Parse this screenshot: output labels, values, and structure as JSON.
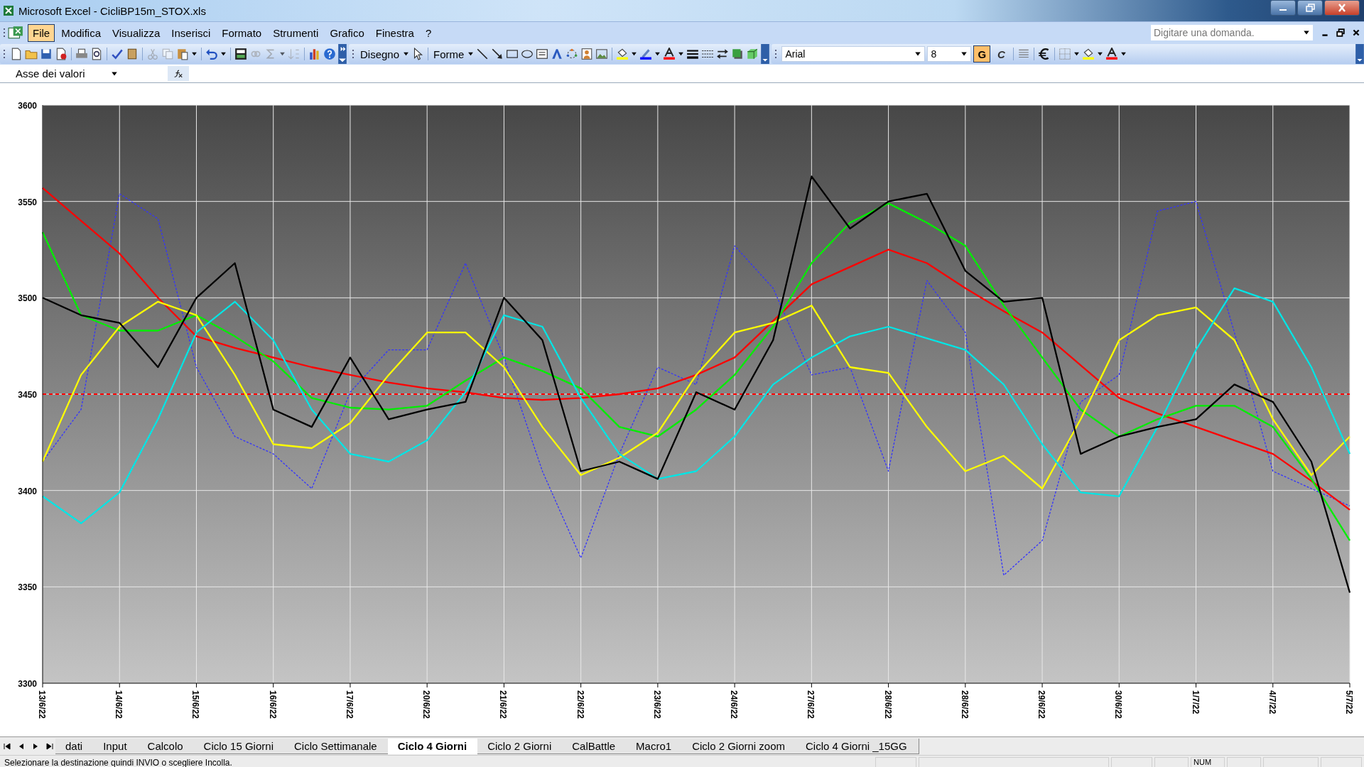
{
  "window": {
    "title": "Microsoft Excel - CicliBP15m_STOX.xls"
  },
  "menu": [
    {
      "label": "File",
      "selected": true
    },
    {
      "label": "Modifica",
      "selected": false
    },
    {
      "label": "Visualizza",
      "selected": false
    },
    {
      "label": "Inserisci",
      "selected": false
    },
    {
      "label": "Formato",
      "selected": false
    },
    {
      "label": "Strumenti",
      "selected": false
    },
    {
      "label": "Grafico",
      "selected": false
    },
    {
      "label": "Finestra",
      "selected": false
    },
    {
      "label": "?",
      "selected": false
    }
  ],
  "help_search": {
    "placeholder": "Digitare una domanda."
  },
  "toolbar": {
    "drawing_menu": "Disegno",
    "shapes_menu": "Forme",
    "font": "Arial",
    "font_size": "8",
    "bold": {
      "label": "G",
      "on": true
    },
    "italic": {
      "label": "C",
      "on": false
    }
  },
  "name_box": "Asse dei valori",
  "chart": {
    "chart_data": {
      "type": "line",
      "ylim": [
        3300,
        3600
      ],
      "yticks": [
        3300,
        3350,
        3400,
        3450,
        3500,
        3550,
        3600
      ],
      "categories": [
        "13/6/22",
        null,
        "14/6/22",
        null,
        "15/6/22",
        null,
        "16/6/22",
        null,
        "17/6/22",
        null,
        "20/6/22",
        null,
        "21/6/22",
        null,
        "22/6/22",
        null,
        "23/6/22",
        null,
        "24/6/22",
        null,
        "27/6/22",
        null,
        "28/6/22",
        null,
        "28/6/22",
        null,
        "29/6/22",
        null,
        "30/6/22",
        null,
        "1/7/22",
        null,
        "4/7/22",
        null,
        "5/7/22"
      ],
      "series": [
        {
          "color": "#ff0000",
          "line_style": "dashed",
          "values": [
            3450,
            3450,
            3450,
            3450,
            3450,
            3450,
            3450,
            3450,
            3450,
            3450,
            3450,
            3450,
            3450,
            3450,
            3450,
            3450,
            3450,
            3450,
            3450,
            3450,
            3450,
            3450,
            3450,
            3450,
            3450,
            3450,
            3450,
            3450,
            3450,
            3450,
            3450,
            3450,
            3450,
            3450,
            3450
          ]
        },
        {
          "color": "#3333ff",
          "line_style": "dotted",
          "values": [
            3415,
            3442,
            3554,
            3541,
            3464,
            3428,
            3419,
            3401,
            3451,
            3473,
            3473,
            3518,
            3469,
            3410,
            3365,
            3419,
            3464,
            3455,
            3527,
            3505,
            3460,
            3464,
            3410,
            3509,
            3482,
            3356,
            3374,
            3446,
            3460,
            3545,
            3550,
            3482,
            3410,
            3401,
            3392
          ]
        },
        {
          "color": "#ff0000",
          "values": [
            3557,
            3540,
            3523,
            3500,
            3480,
            3474,
            3469,
            3464,
            3460,
            3456,
            3453,
            3451,
            3448,
            3447,
            3448,
            3450,
            3453,
            3460,
            3469,
            3488,
            3507,
            3516,
            3525,
            3518,
            3505,
            3493,
            3482,
            3465,
            3448,
            3440,
            3433,
            3426,
            3419,
            3405,
            3390
          ]
        },
        {
          "color": "#00ee00",
          "values": [
            3534,
            3491,
            3483,
            3483,
            3491,
            3480,
            3467,
            3448,
            3443,
            3442,
            3444,
            3457,
            3469,
            3462,
            3453,
            3433,
            3428,
            3442,
            3460,
            3485,
            3518,
            3539,
            3549,
            3539,
            3527,
            3496,
            3469,
            3442,
            3428,
            3437,
            3444,
            3444,
            3433,
            3406,
            3374
          ]
        },
        {
          "color": "#ffff00",
          "values": [
            3415,
            3460,
            3485,
            3498,
            3491,
            3460,
            3424,
            3422,
            3435,
            3460,
            3482,
            3482,
            3464,
            3433,
            3408,
            3417,
            3430,
            3460,
            3482,
            3487,
            3496,
            3464,
            3461,
            3433,
            3410,
            3418,
            3401,
            3437,
            3478,
            3491,
            3495,
            3478,
            3437,
            3408,
            3428
          ]
        },
        {
          "color": "#00e5e5",
          "values": [
            3397,
            3383,
            3399,
            3437,
            3482,
            3498,
            3478,
            3442,
            3419,
            3415,
            3426,
            3451,
            3491,
            3485,
            3448,
            3419,
            3406,
            3410,
            3428,
            3455,
            3469,
            3480,
            3485,
            3479,
            3473,
            3455,
            3424,
            3399,
            3397,
            3433,
            3473,
            3505,
            3498,
            3464,
            3419
          ]
        },
        {
          "color": "#000000",
          "values": [
            3500,
            3491,
            3487,
            3464,
            3500,
            3518,
            3442,
            3433,
            3469,
            3437,
            3442,
            3446,
            3500,
            3478,
            3410,
            3415,
            3406,
            3451,
            3442,
            3478,
            3563,
            3536,
            3550,
            3554,
            3514,
            3498,
            3500,
            3419,
            3428,
            3433,
            3437,
            3455,
            3446,
            3415,
            3347
          ]
        }
      ],
      "grid": true
    }
  },
  "sheet_tabs": [
    {
      "label": "dati",
      "selected": false
    },
    {
      "label": "Input",
      "selected": false
    },
    {
      "label": "Calcolo",
      "selected": false
    },
    {
      "label": "Ciclo 15 Giorni",
      "selected": false
    },
    {
      "label": "Ciclo Settimanale",
      "selected": false
    },
    {
      "label": "Ciclo 4 Giorni",
      "selected": true
    },
    {
      "label": "Ciclo 2 Giorni",
      "selected": false
    },
    {
      "label": "CalBattle",
      "selected": false
    },
    {
      "label": "Macro1",
      "selected": false
    },
    {
      "label": "Ciclo 2 Giorni zoom",
      "selected": false
    },
    {
      "label": "Ciclo 4 Giorni _15GG",
      "selected": false
    }
  ],
  "status_bar": {
    "message": "Selezionare la destinazione quindi INVIO o scegliere Incolla.",
    "indicator": "NUM"
  }
}
